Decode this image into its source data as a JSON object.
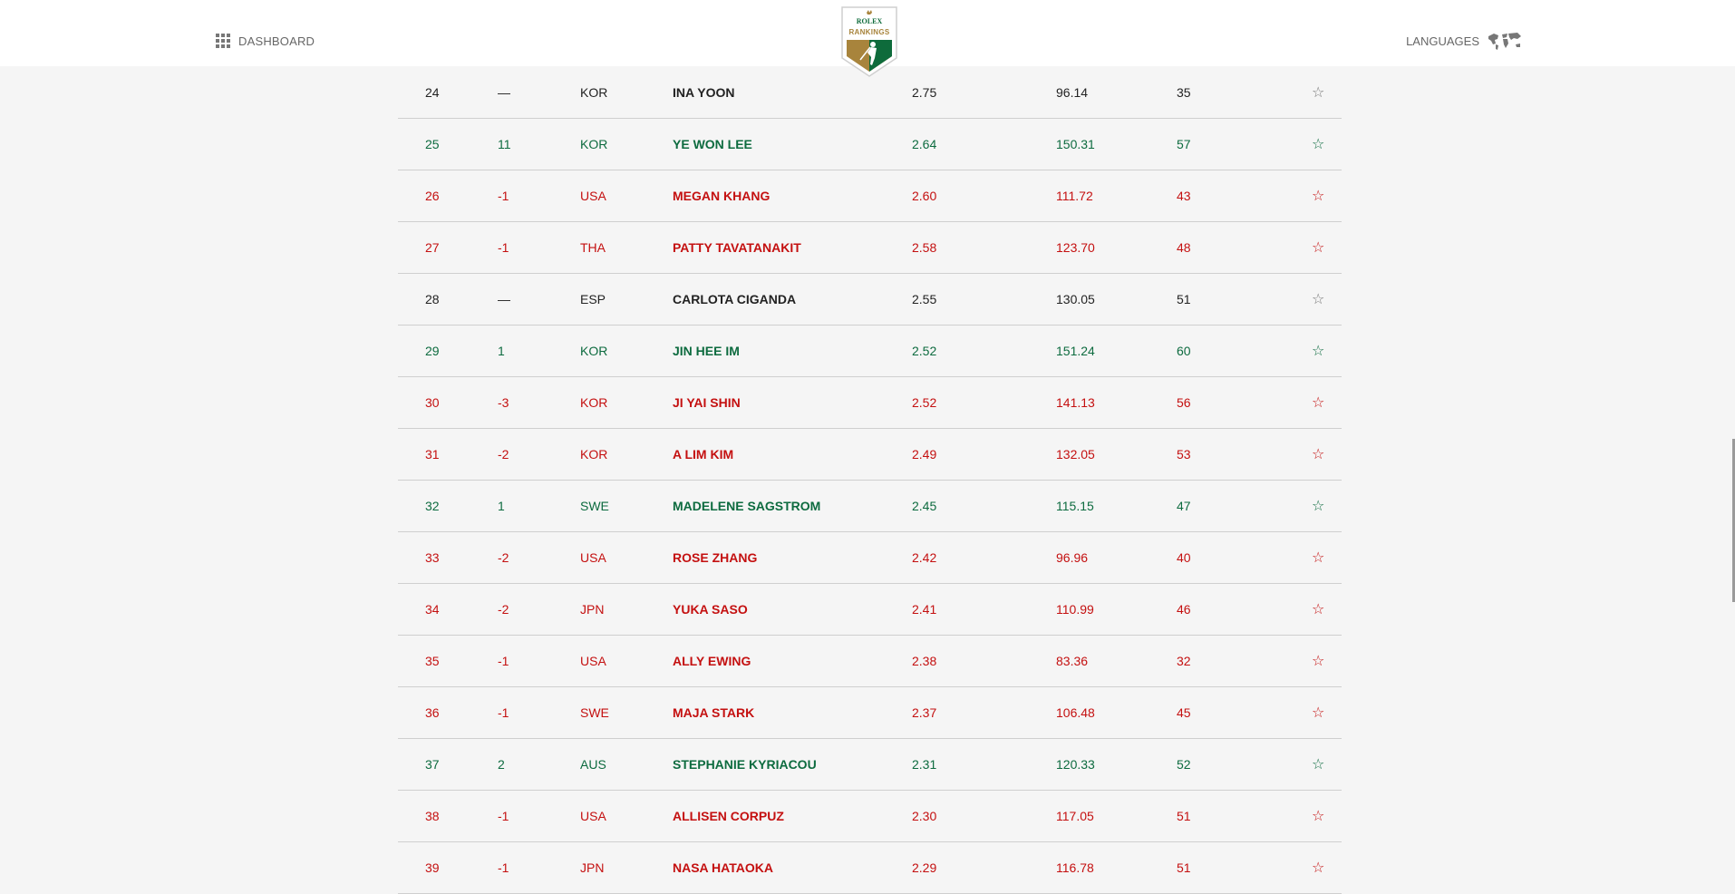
{
  "header": {
    "dashboard_label": "DASHBOARD",
    "languages_label": "LANGUAGES",
    "logo_brand": "ROLEX",
    "logo_title": "RANKINGS"
  },
  "colors": {
    "up": "#0d6b3f",
    "down": "#c41010",
    "neutral": "#222222",
    "logo_gold": "#a8843c",
    "logo_green": "#0e6b3b"
  },
  "rankings": [
    {
      "rank": "24",
      "move": "—",
      "country": "KOR",
      "name": "INA YOON",
      "avg": "2.75",
      "total": "96.14",
      "events": "35",
      "trend": "neutral"
    },
    {
      "rank": "25",
      "move": "11",
      "country": "KOR",
      "name": "YE WON LEE",
      "avg": "2.64",
      "total": "150.31",
      "events": "57",
      "trend": "up"
    },
    {
      "rank": "26",
      "move": "-1",
      "country": "USA",
      "name": "MEGAN KHANG",
      "avg": "2.60",
      "total": "111.72",
      "events": "43",
      "trend": "down"
    },
    {
      "rank": "27",
      "move": "-1",
      "country": "THA",
      "name": "PATTY TAVATANAKIT",
      "avg": "2.58",
      "total": "123.70",
      "events": "48",
      "trend": "down"
    },
    {
      "rank": "28",
      "move": "—",
      "country": "ESP",
      "name": "CARLOTA CIGANDA",
      "avg": "2.55",
      "total": "130.05",
      "events": "51",
      "trend": "neutral"
    },
    {
      "rank": "29",
      "move": "1",
      "country": "KOR",
      "name": "JIN HEE IM",
      "avg": "2.52",
      "total": "151.24",
      "events": "60",
      "trend": "up"
    },
    {
      "rank": "30",
      "move": "-3",
      "country": "KOR",
      "name": "JI YAI SHIN",
      "avg": "2.52",
      "total": "141.13",
      "events": "56",
      "trend": "down"
    },
    {
      "rank": "31",
      "move": "-2",
      "country": "KOR",
      "name": "A LIM KIM",
      "avg": "2.49",
      "total": "132.05",
      "events": "53",
      "trend": "down"
    },
    {
      "rank": "32",
      "move": "1",
      "country": "SWE",
      "name": "MADELENE SAGSTROM",
      "avg": "2.45",
      "total": "115.15",
      "events": "47",
      "trend": "up"
    },
    {
      "rank": "33",
      "move": "-2",
      "country": "USA",
      "name": "ROSE ZHANG",
      "avg": "2.42",
      "total": "96.96",
      "events": "40",
      "trend": "down"
    },
    {
      "rank": "34",
      "move": "-2",
      "country": "JPN",
      "name": "YUKA SASO",
      "avg": "2.41",
      "total": "110.99",
      "events": "46",
      "trend": "down"
    },
    {
      "rank": "35",
      "move": "-1",
      "country": "USA",
      "name": "ALLY EWING",
      "avg": "2.38",
      "total": "83.36",
      "events": "32",
      "trend": "down"
    },
    {
      "rank": "36",
      "move": "-1",
      "country": "SWE",
      "name": "MAJA STARK",
      "avg": "2.37",
      "total": "106.48",
      "events": "45",
      "trend": "down"
    },
    {
      "rank": "37",
      "move": "2",
      "country": "AUS",
      "name": "STEPHANIE KYRIACOU",
      "avg": "2.31",
      "total": "120.33",
      "events": "52",
      "trend": "up"
    },
    {
      "rank": "38",
      "move": "-1",
      "country": "USA",
      "name": "ALLISEN CORPUZ",
      "avg": "2.30",
      "total": "117.05",
      "events": "51",
      "trend": "down"
    },
    {
      "rank": "39",
      "move": "-1",
      "country": "JPN",
      "name": "NASA HATAOKA",
      "avg": "2.29",
      "total": "116.78",
      "events": "51",
      "trend": "down"
    }
  ],
  "star_glyph": "☆"
}
